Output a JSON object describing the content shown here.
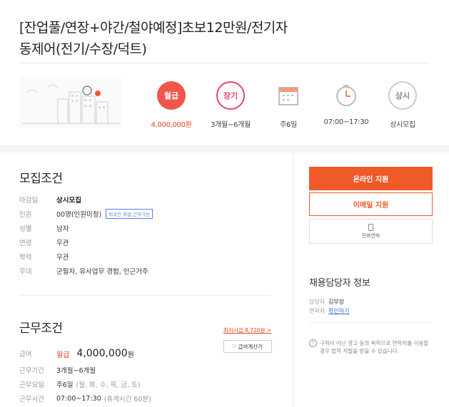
{
  "title": {
    "line1": "[잔업풀/연장+야간/철야예정]초보12만원/전기자",
    "line2": "동제어(전기/수장/덕트)"
  },
  "summary": [
    {
      "icon": "pay-icon",
      "icon_text": "월급",
      "label": "4,000,000원"
    },
    {
      "icon": "period-icon",
      "icon_text": "장기",
      "label": "3개월~6개월"
    },
    {
      "icon": "calendar-icon",
      "icon_text": "",
      "label": "주6일"
    },
    {
      "icon": "clock-icon",
      "icon_text": "",
      "label": "07:00~17:30"
    },
    {
      "icon": "always-icon",
      "icon_text": "상시",
      "label": "상시모집"
    }
  ],
  "recruit": {
    "title": "모집조건",
    "rows": [
      {
        "key": "마감일",
        "value": "상시모집"
      },
      {
        "key": "인원",
        "value": "00명(인원미정)",
        "tag": "외국인 취업 근무가능"
      },
      {
        "key": "성별",
        "value": "남자"
      },
      {
        "key": "연령",
        "value": "무관"
      },
      {
        "key": "학력",
        "value": "무관"
      },
      {
        "key": "우대",
        "value": "군필자, 유사업무 경험, 인근거주"
      }
    ]
  },
  "work": {
    "title": "근무조건",
    "min_wage_link": "최저시급 8,720원 >",
    "calc_button": "급여계산기",
    "salary_key": "급여",
    "salary_type": "월급",
    "salary_amount": "4,000,000",
    "salary_unit": "원",
    "rows": [
      {
        "key": "근무기간",
        "value": "3개월~6개월"
      },
      {
        "key": "근무요일",
        "value": "주6일",
        "note": "(월, 화, 수, 목, 금, 토)"
      },
      {
        "key": "근무시간",
        "value": "07:00~17:30",
        "note": "(휴게시간 60분)"
      }
    ]
  },
  "actions": {
    "online_apply": "온라인 지원",
    "email_apply": "이메일 지원",
    "phone_contact": "전화연락"
  },
  "contact": {
    "title": "채용담당자 정보",
    "manager_key": "담당자",
    "manager_value": "김부장",
    "phone_key": "연락처",
    "phone_value": "확인하기"
  },
  "notice": "구직이 아닌 광고 등의 목적으로 연락처를 이용할 경우 법적 처벌을 받을 수 있습니다.",
  "colors": {
    "accent": "#f05a28",
    "pay_red": "#f0564a",
    "pink": "#e8456b",
    "link_blue": "#3a6dd8"
  }
}
